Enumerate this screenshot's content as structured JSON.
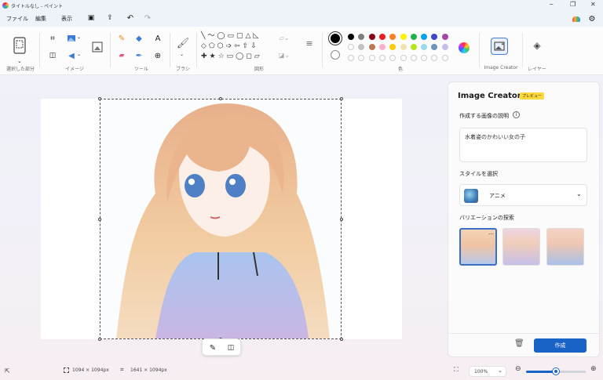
{
  "window": {
    "title": "タイトルなし - ペイント"
  },
  "menu": {
    "file": "ファイル",
    "edit": "編集",
    "view": "表示"
  },
  "ribbon": {
    "groups": {
      "selection": "選択した部分",
      "image": "イメージ",
      "tools": "ツール",
      "brushes": "ブラシ",
      "shapes": "図形",
      "colors": "色",
      "image_creator": "Image Creator",
      "layers": "レイヤー"
    },
    "tool_icons": [
      "crop-icon",
      "resize-icon",
      "rotate-icon",
      "flip-icon",
      "image-select-icon",
      "pencil-icon",
      "fill-icon",
      "text-icon",
      "eraser-icon",
      "color-picker-icon",
      "magnifier-icon",
      "brush-icon"
    ],
    "colors": {
      "current_primary": "#000000",
      "current_secondary": "#ffffff",
      "row1": [
        "#000000",
        "#7f7f7f",
        "#880015",
        "#ed1c24",
        "#ff7f27",
        "#fff200",
        "#22b14c",
        "#00a2e8",
        "#3f48cc",
        "#a349a4"
      ],
      "row2": [
        "#ffffff",
        "#c3c3c3",
        "#b97a57",
        "#ffaec9",
        "#ffc90e",
        "#efe4b0",
        "#b5e61d",
        "#99d9ea",
        "#7092be",
        "#c8bfe7"
      ]
    }
  },
  "panel": {
    "title": "Image Creator",
    "badge": "プレビュー",
    "prompt_label": "作成する画像の説明",
    "prompt_value": "水着姿のかわいい女の子",
    "style_label": "スタイルを選択",
    "style_value": "アニメ",
    "variations_label": "バリエーションの探索",
    "create_button": "作成"
  },
  "status": {
    "selection_size": "1094 × 1094px",
    "canvas_size": "1641 × 1094px",
    "zoom": "100%",
    "zoom_level": 0.5
  }
}
